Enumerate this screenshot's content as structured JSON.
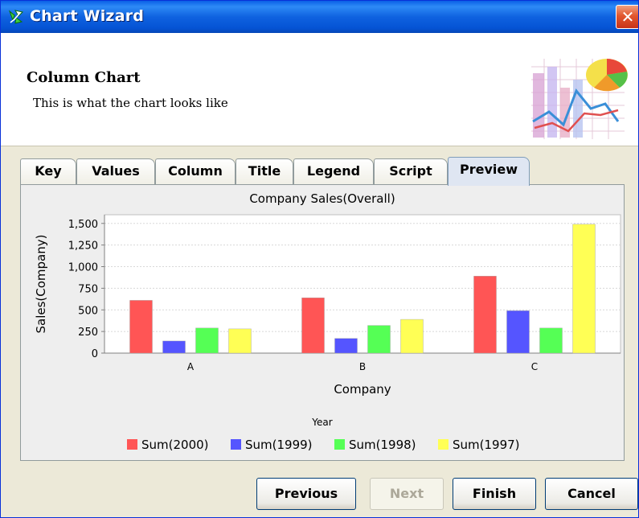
{
  "window": {
    "title": "Chart Wizard",
    "close_glyph": "✕"
  },
  "header": {
    "title": "Column Chart",
    "subtitle": "This is what the chart looks like"
  },
  "tabs": [
    {
      "label": "Key"
    },
    {
      "label": "Values"
    },
    {
      "label": "Column"
    },
    {
      "label": "Title"
    },
    {
      "label": "Legend"
    },
    {
      "label": "Script"
    },
    {
      "label": "Preview",
      "active": true
    }
  ],
  "chart_data": {
    "type": "bar",
    "title": "Company Sales(Overall)",
    "xlabel": "Company",
    "ylabel": "Sales(Company)",
    "categories": [
      "A",
      "B",
      "C"
    ],
    "yticks": [
      "0",
      "250",
      "500",
      "750",
      "1,000",
      "1,250",
      "1,500"
    ],
    "ylim": [
      0,
      1600
    ],
    "series": [
      {
        "name": "Sum(2000)",
        "color": "#ff5555",
        "values": [
          610,
          640,
          890
        ]
      },
      {
        "name": "Sum(1999)",
        "color": "#5555ff",
        "values": [
          140,
          170,
          490
        ]
      },
      {
        "name": "Sum(1998)",
        "color": "#55ff55",
        "values": [
          290,
          320,
          290
        ]
      },
      {
        "name": "Sum(1997)",
        "color": "#ffff55",
        "values": [
          280,
          390,
          1490
        ]
      }
    ],
    "legend_title": "Year",
    "legend_position": "bottom",
    "grid": true
  },
  "buttons": {
    "previous": "Previous",
    "next": "Next",
    "finish": "Finish",
    "cancel": "Cancel"
  },
  "icons": {
    "app": "chart-wizard-icon",
    "header": "chart-graphic-icon",
    "close": "close-icon"
  }
}
